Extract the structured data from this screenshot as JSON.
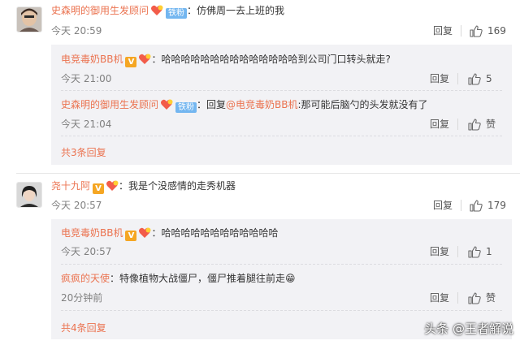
{
  "colors": {
    "username": "#eb7350",
    "text": "#333333",
    "meta": "#808080",
    "reply_bg": "#f2f2f5",
    "fan_badge": "#73b6f0"
  },
  "comments": [
    {
      "username": "史森明的御用生发顾问",
      "badge": "铁粉",
      "separator": "：",
      "text": "仿佛周一去上班的我",
      "time": "今天 20:59",
      "reply_label": "回复",
      "like_count": "169",
      "replies": [
        {
          "username": "电竞毒奶BB机",
          "badge_v": "V",
          "separator": "：",
          "text": "哈哈哈哈哈哈哈哈哈哈哈哈哈哈到公司门口转头就走?",
          "time": "今天 21:00",
          "reply_label": "回复",
          "like_count": "5"
        },
        {
          "username": "史森明的御用生发顾问",
          "badge": "铁粉",
          "separator": "：",
          "reply_prefix": "回复",
          "mention": "@电竞毒奶BB机",
          "text": ":那可能后脑勺的头发就没有了",
          "time": "今天 21:04",
          "reply_label": "回复",
          "like_label": "赞"
        }
      ],
      "more_replies": "共3条回复"
    },
    {
      "username": "尧十九阿",
      "badge_v": "V",
      "separator": "：",
      "text": "我是个没感情的走秀机器",
      "time": "今天 20:57",
      "reply_label": "回复",
      "like_count": "179",
      "replies": [
        {
          "username": "电竞毒奶BB机",
          "badge_v": "V",
          "separator": "：",
          "text": "哈哈哈哈哈哈哈哈哈哈哈哈",
          "time": "今天 20:57",
          "reply_label": "回复",
          "like_count": "1"
        },
        {
          "username": "疯疯的天使",
          "separator": "：",
          "text": "特像植物大战僵尸，僵尸推着腿往前走",
          "emoji": "😁",
          "time": "20分钟前",
          "reply_label": "回复",
          "like_label": "赞"
        }
      ],
      "more_replies": "共4条回复"
    }
  ],
  "watermark": "头条 @王者解说"
}
